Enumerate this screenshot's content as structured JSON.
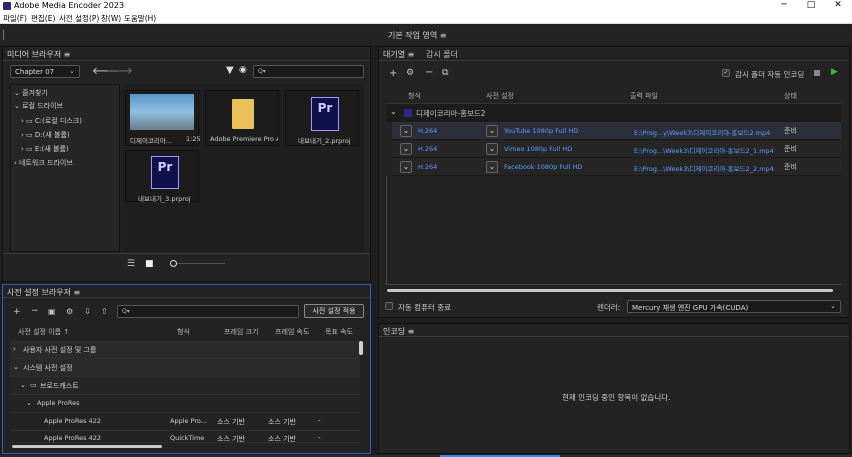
{
  "window": {
    "title": "Adobe Media Encoder 2023",
    "min": "─",
    "max": "□",
    "close": "✕"
  },
  "menu": [
    "파일(F)",
    "편집(E)",
    "사전 설정(P)",
    "창(W)",
    "도움말(H)"
  ],
  "workspace": {
    "label": "기본 작업 영역 ≡"
  },
  "media_browser": {
    "title": "미디어 브라우저 ≡",
    "folder_select": "Chapter 07",
    "search_placeholder": "Q▾",
    "tree": [
      "즐겨찾기",
      "로컬 드라이브",
      "C:(로컬 디스크)",
      "D:(새 볼륨)",
      "E:(새 볼륨)",
      "네트워크 드라이브"
    ],
    "items": [
      {
        "name": "디제이코리아...",
        "duration": "1:25"
      },
      {
        "name": "Adobe Premiere Pro Au..."
      },
      {
        "name": "내보내기_2.prproj"
      },
      {
        "name": "내보내기_3.prproj"
      }
    ]
  },
  "queue": {
    "tab_queue": "대기열 ≡",
    "tab_watch": "감시 폴더",
    "auto_encode": "감시 폴더 자동 인코딩",
    "columns": [
      "형식",
      "사전 설정",
      "출력 파일",
      "상태"
    ],
    "group": "디제이코리아-홍보드2",
    "rows": [
      {
        "format": "H.264",
        "preset": "YouTube 1080p Full HD",
        "output": "E:\\Prog...y\\Week3\\디제이코리아-홍보드2.mp4",
        "status": "준비"
      },
      {
        "format": "H.264",
        "preset": "Vimeo 1080p Full HD",
        "output": "E:\\Prog...\\Week3\\디제이코리아-홍보드2_1.mp4",
        "status": "준비"
      },
      {
        "format": "H.264",
        "preset": "Facebook 1080p Full HD",
        "output": "E:\\Prog...\\Week3\\디제이코리아-홍보드2_2.mp4",
        "status": "준비"
      }
    ],
    "shutdown_label": "자동 컴퓨터 종료",
    "renderer_label": "렌더러:",
    "renderer_value": "Mercury 재생 엔진 GPU 가속(CUDA)"
  },
  "preset_browser": {
    "title": "사전 설정 브라우저 ≡",
    "apply_button": "사전 설정 적용",
    "search_placeholder": "Q▾",
    "columns": [
      "사전 설정 이름 ↑",
      "형식",
      "프레임 크기",
      "프레임 속도",
      "목표 속도"
    ],
    "rows": [
      {
        "name": "사용자 사전 설정 및 그룹",
        "level": 0
      },
      {
        "name": "시스템 사전 설정",
        "level": 0
      },
      {
        "name": "브로드캐스트",
        "level": 1
      },
      {
        "name": "Apple ProRes",
        "level": 2
      },
      {
        "name": "Apple ProRes 422",
        "format": "Apple Pro...",
        "size": "소스 기반",
        "rate": "소스 기반",
        "target": "-"
      },
      {
        "name": "Apple ProRes 422",
        "format": "QuickTime",
        "size": "소스 기반",
        "rate": "소스 기반",
        "target": "-"
      }
    ]
  },
  "encoding": {
    "title": "인코딩 ≡",
    "empty_message": "현재 인코딩 중인 항목이 없습니다."
  },
  "colors": {
    "accent": "#2d8ceb",
    "play": "#3fb83f",
    "selected_row": "#2b2f39"
  }
}
